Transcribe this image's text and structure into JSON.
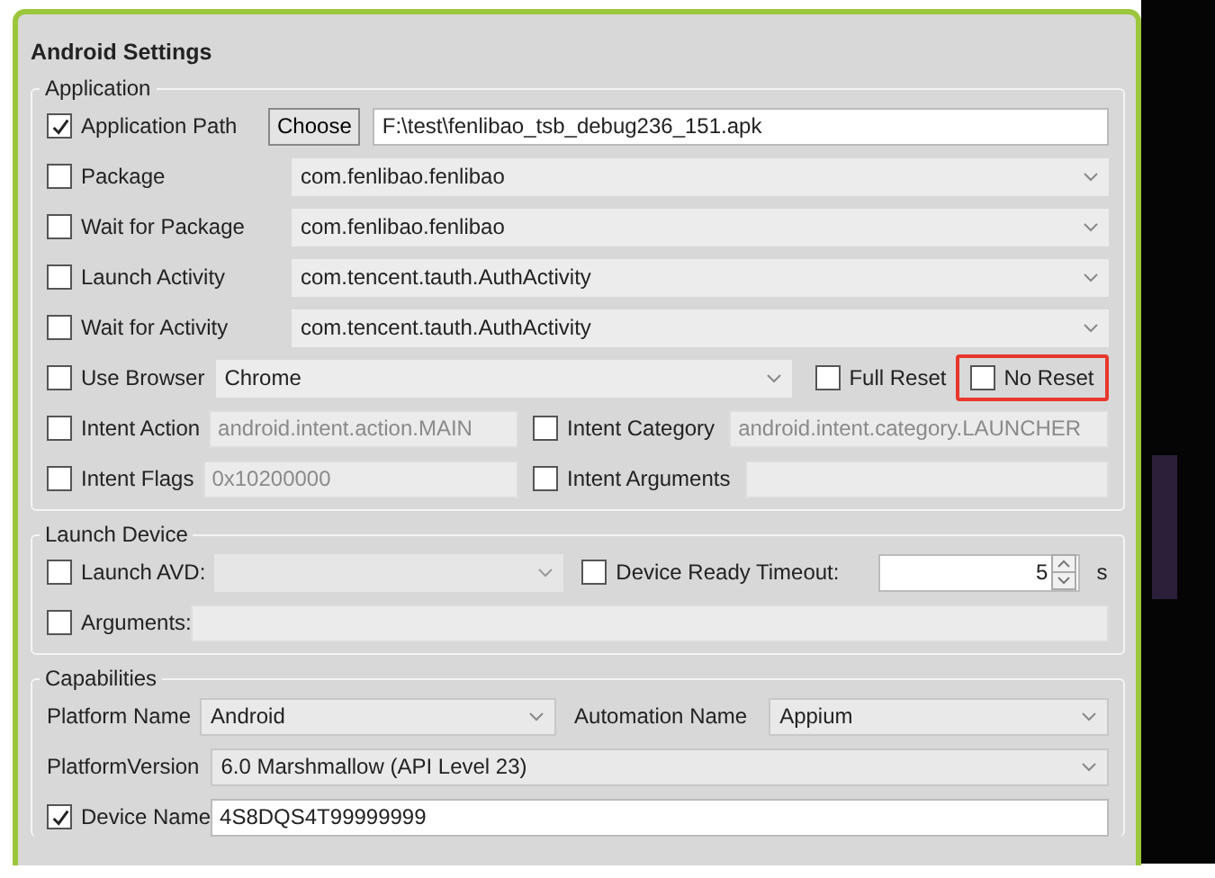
{
  "window": {
    "title": "Android Settings"
  },
  "application": {
    "title": "Application",
    "app_path": {
      "label": "Application Path",
      "checked": true,
      "button": "Choose",
      "value": "F:\\test\\fenlibao_tsb_debug236_151.apk"
    },
    "combo_rows": [
      {
        "label": "Package",
        "checked": false,
        "value": "com.fenlibao.fenlibao"
      },
      {
        "label": "Wait for Package",
        "checked": false,
        "value": "com.fenlibao.fenlibao"
      },
      {
        "label": "Launch Activity",
        "checked": false,
        "value": "com.tencent.tauth.AuthActivity"
      },
      {
        "label": "Wait for Activity",
        "checked": false,
        "value": "com.tencent.tauth.AuthActivity"
      }
    ],
    "browser": {
      "label": "Use Browser",
      "checked": false,
      "value": "Chrome"
    },
    "full_reset": {
      "label": "Full Reset",
      "checked": false
    },
    "no_reset": {
      "label": "No Reset",
      "checked": false,
      "highlighted": true
    },
    "intent_rows": [
      [
        {
          "label": "Intent Action",
          "checked": false,
          "placeholder": "android.intent.action.MAIN"
        },
        {
          "label": "Intent Category",
          "checked": false,
          "placeholder": "android.intent.category.LAUNCHER"
        }
      ],
      [
        {
          "label": "Intent Flags",
          "checked": false,
          "placeholder": "0x10200000"
        },
        {
          "label": "Intent Arguments",
          "checked": false
        }
      ]
    ]
  },
  "launch_device": {
    "title": "Launch Device",
    "avd": {
      "label": "Launch AVD:",
      "checked": false
    },
    "timeout": {
      "label": "Device Ready Timeout:",
      "checked": false,
      "value": "5",
      "unit": "s"
    },
    "arguments": {
      "label": "Arguments:",
      "checked": false
    }
  },
  "capabilities": {
    "title": "Capabilities",
    "platform_name": {
      "label": "Platform Name",
      "value": "Android"
    },
    "automation_name": {
      "label": "Automation Name",
      "value": "Appium"
    },
    "platform_version": {
      "label": "PlatformVersion",
      "value": "6.0 Marshmallow (API Level 23)"
    },
    "device_name": {
      "label": "Device Name",
      "checked": true,
      "value": "4S8DQS4T99999999"
    }
  }
}
